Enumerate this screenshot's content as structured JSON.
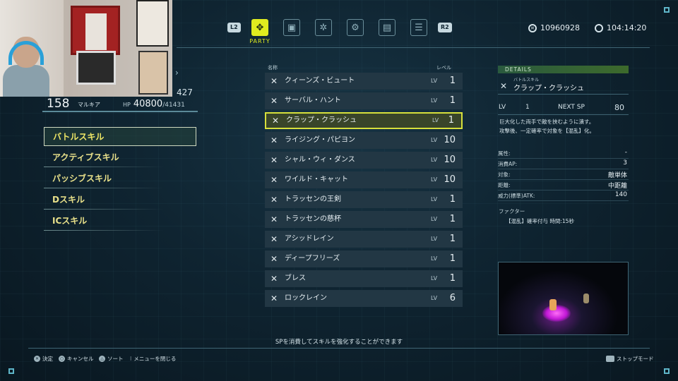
{
  "top": {
    "left_button": "L2",
    "right_button": "R2",
    "active_tab_label": "PARTY",
    "gold": "10960928",
    "playtime": "104:14:20"
  },
  "character": {
    "level": "158",
    "name": "マルキア",
    "hp_label": "HP",
    "hp": "40800",
    "hp_max": "/41431",
    "sp": "427"
  },
  "menu": [
    "バトルスキル",
    "アクティブスキル",
    "パッシブスキル",
    "Dスキル",
    "ICスキル"
  ],
  "list": {
    "header_name": "名称",
    "header_level": "レベル",
    "lv_tag": "LV",
    "items": [
      {
        "name": "クィーンズ・ビュート",
        "lv": "1"
      },
      {
        "name": "サーバル・ハント",
        "lv": "1"
      },
      {
        "name": "クラップ・クラッシュ",
        "lv": "1"
      },
      {
        "name": "ライジング・パピヨン",
        "lv": "10"
      },
      {
        "name": "シャル・ウィ・ダンス",
        "lv": "10"
      },
      {
        "name": "ワイルド・キャット",
        "lv": "10"
      },
      {
        "name": "トラッセンの王剣",
        "lv": "1"
      },
      {
        "name": "トラッセンの慈杯",
        "lv": "1"
      },
      {
        "name": "アシッドレイン",
        "lv": "1"
      },
      {
        "name": "ディープフリーズ",
        "lv": "1"
      },
      {
        "name": "ブレス",
        "lv": "1"
      },
      {
        "name": "ロックレイン",
        "lv": "6"
      }
    ]
  },
  "details": {
    "header": "DETAILS",
    "category": "バトルスキル",
    "name": "クラップ・クラッシュ",
    "lv_label": "LV",
    "lv": "1",
    "next_sp_label": "NEXT SP",
    "next_sp": "80",
    "desc1": "巨大化した両手で敵を挟むように潰す。",
    "desc2": "攻撃後、一定確率で対象を【混乱】化。",
    "attrs": [
      {
        "label": "属性:",
        "value": "-"
      },
      {
        "label": "消費AP:",
        "value": "3"
      },
      {
        "label": "対象:",
        "value": "敵単体"
      },
      {
        "label": "距離:",
        "value": "中距離"
      },
      {
        "label": "威力(標準)ATK:",
        "value": "140"
      }
    ],
    "factor_label": "ファクター",
    "factor": "【混乱】確率付与 時間:15秒"
  },
  "hint": "SPを消費してスキルを強化することができます",
  "bottom": {
    "confirm": "決定",
    "cancel": "キャンセル",
    "sort": "ソート",
    "close": "メニューを閉じる",
    "stop": "ストップモード"
  },
  "colors": {
    "accent": "#e0ec1f",
    "panel": "#223744"
  }
}
